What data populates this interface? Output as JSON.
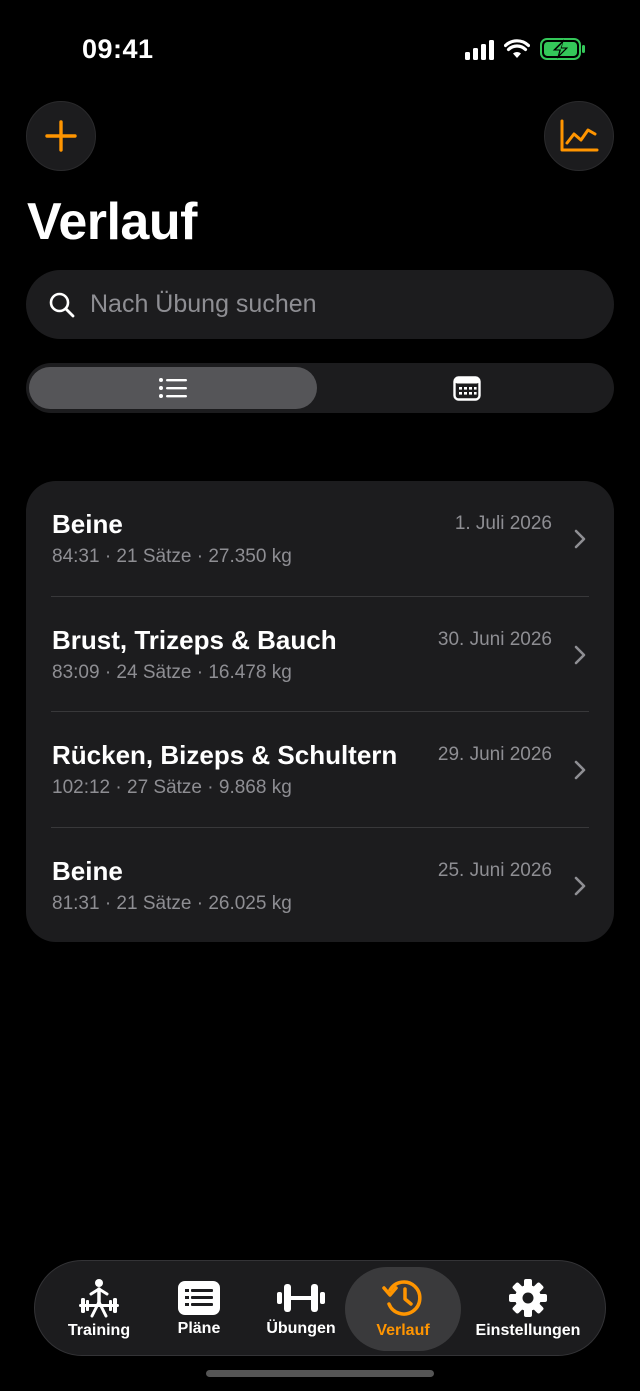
{
  "status_bar": {
    "time": "09:41",
    "battery_color": "#34c759"
  },
  "header": {
    "title": "Verlauf",
    "add_icon": "plus-icon",
    "stats_icon": "line-chart-icon"
  },
  "search": {
    "placeholder": "Nach Übung suchen",
    "value": ""
  },
  "segmented": {
    "options": [
      {
        "icon": "list-icon",
        "selected": true
      },
      {
        "icon": "calendar-icon",
        "selected": false
      }
    ]
  },
  "workouts": [
    {
      "title": "Beine",
      "date": "1. Juli 2026",
      "summary": "84:31 · 21 Sätze · 27.350 kg"
    },
    {
      "title": "Brust, Trizeps & Bauch",
      "date": "30. Juni 2026",
      "summary": "83:09 · 24 Sätze · 16.478 kg"
    },
    {
      "title": "Rücken, Bizeps & Schultern",
      "date": "29. Juni 2026",
      "summary": "102:12 · 27 Sätze · 9.868 kg"
    },
    {
      "title": "Beine",
      "date": "25. Juni 2026",
      "summary": "81:31 · 21 Sätze · 26.025 kg"
    }
  ],
  "tabs": [
    {
      "label": "Training",
      "icon": "weightlifter-icon"
    },
    {
      "label": "Pläne",
      "icon": "plan-list-icon"
    },
    {
      "label": "Übungen",
      "icon": "dumbbell-icon"
    },
    {
      "label": "Verlauf",
      "icon": "history-clock-icon",
      "active": true
    },
    {
      "label": "Einstellungen",
      "icon": "gear-icon"
    }
  ],
  "colors": {
    "accent": "#ff9500",
    "background": "#000000",
    "card": "#1c1c1e",
    "secondary_text": "#8e8e93"
  }
}
